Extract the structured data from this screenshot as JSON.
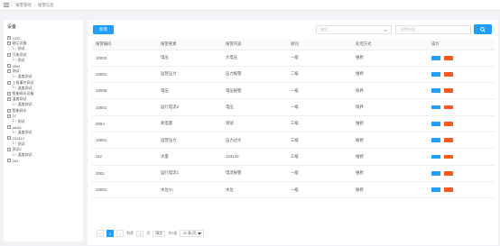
{
  "breadcrumb": {
    "items": [
      "报警管理",
      "报警信息"
    ]
  },
  "tree": {
    "title": "设备",
    "nodes": [
      {
        "label": "1222",
        "type": "branch",
        "indent": 0
      },
      {
        "label": "烟尘设备",
        "type": "branch",
        "indent": 0
      },
      {
        "label": "测试",
        "type": "leaf",
        "indent": 1
      },
      {
        "label": "污废测试",
        "type": "branch",
        "indent": 0
      },
      {
        "label": "测试",
        "type": "leaf",
        "indent": 1
      },
      {
        "label": "4504",
        "type": "branch",
        "indent": 0
      },
      {
        "label": "测试",
        "type": "branch",
        "indent": 0
      },
      {
        "label": "温度测试",
        "type": "leaf",
        "indent": 1
      },
      {
        "label": "上报事件测试",
        "type": "branch",
        "indent": 0
      },
      {
        "label": "温度测试",
        "type": "leaf",
        "indent": 1
      },
      {
        "label": "智能阀水设备",
        "type": "branch",
        "indent": 0
      },
      {
        "label": "温度测试",
        "type": "branch",
        "indent": 0
      },
      {
        "label": "温度测试",
        "type": "leaf",
        "indent": 1
      },
      {
        "label": "智能阀水",
        "type": "branch",
        "indent": 0
      },
      {
        "label": "12",
        "type": "branch",
        "indent": 0
      },
      {
        "label": "测试",
        "type": "leaf",
        "indent": 1
      },
      {
        "label": "aAAA",
        "type": "branch",
        "indent": 0
      },
      {
        "label": "温度测试",
        "type": "leaf",
        "indent": 1
      },
      {
        "label": "231312",
        "type": "branch",
        "indent": 0
      },
      {
        "label": "测试",
        "type": "leaf",
        "indent": 1
      },
      {
        "label": "测试2",
        "type": "branch",
        "indent": 0
      },
      {
        "label": "温度测试",
        "type": "leaf",
        "indent": 1
      },
      {
        "label": "343",
        "type": "branch",
        "indent": 0
      }
    ]
  },
  "toolbar": {
    "add_label": "新增",
    "select_placeholder": "级别",
    "search_placeholder": "报警内容"
  },
  "table": {
    "headers": [
      "报警编码",
      "报警要素",
      "报警内容",
      "级别",
      "处理方式",
      "操作"
    ],
    "rows": [
      [
        "10002",
        "电压",
        "大电压",
        "一级",
        "维修"
      ],
      [
        "10001",
        "运营压力",
        "压力报警",
        "二级",
        "维修"
      ],
      [
        "10006",
        "电压",
        "电压报警",
        "一级",
        "保养"
      ],
      [
        "10001",
        "运行电流2",
        "电压",
        "一级",
        "保养"
      ],
      [
        "000A",
        "耗电量",
        "测试",
        "三级",
        "维修"
      ],
      [
        "10001",
        "运营压力",
        "压力过大",
        "三级",
        "报修"
      ],
      [
        "112",
        "水量",
        "123132",
        "三级",
        "维修"
      ],
      [
        "2001",
        "运行电流1",
        "电流报警",
        "一级",
        "维修"
      ],
      [
        "10001",
        "水位/m",
        "水位",
        "一级",
        "报修"
      ]
    ]
  },
  "pagination": {
    "prev": "‹",
    "current": "1",
    "next": "›",
    "goto_label": "到第",
    "goto_value": "1",
    "page_unit": "页",
    "confirm": "确定",
    "total": "共9条",
    "page_size": "20 条/页"
  },
  "colors": {
    "primary": "#1e9fff",
    "danger": "#ff5722"
  }
}
